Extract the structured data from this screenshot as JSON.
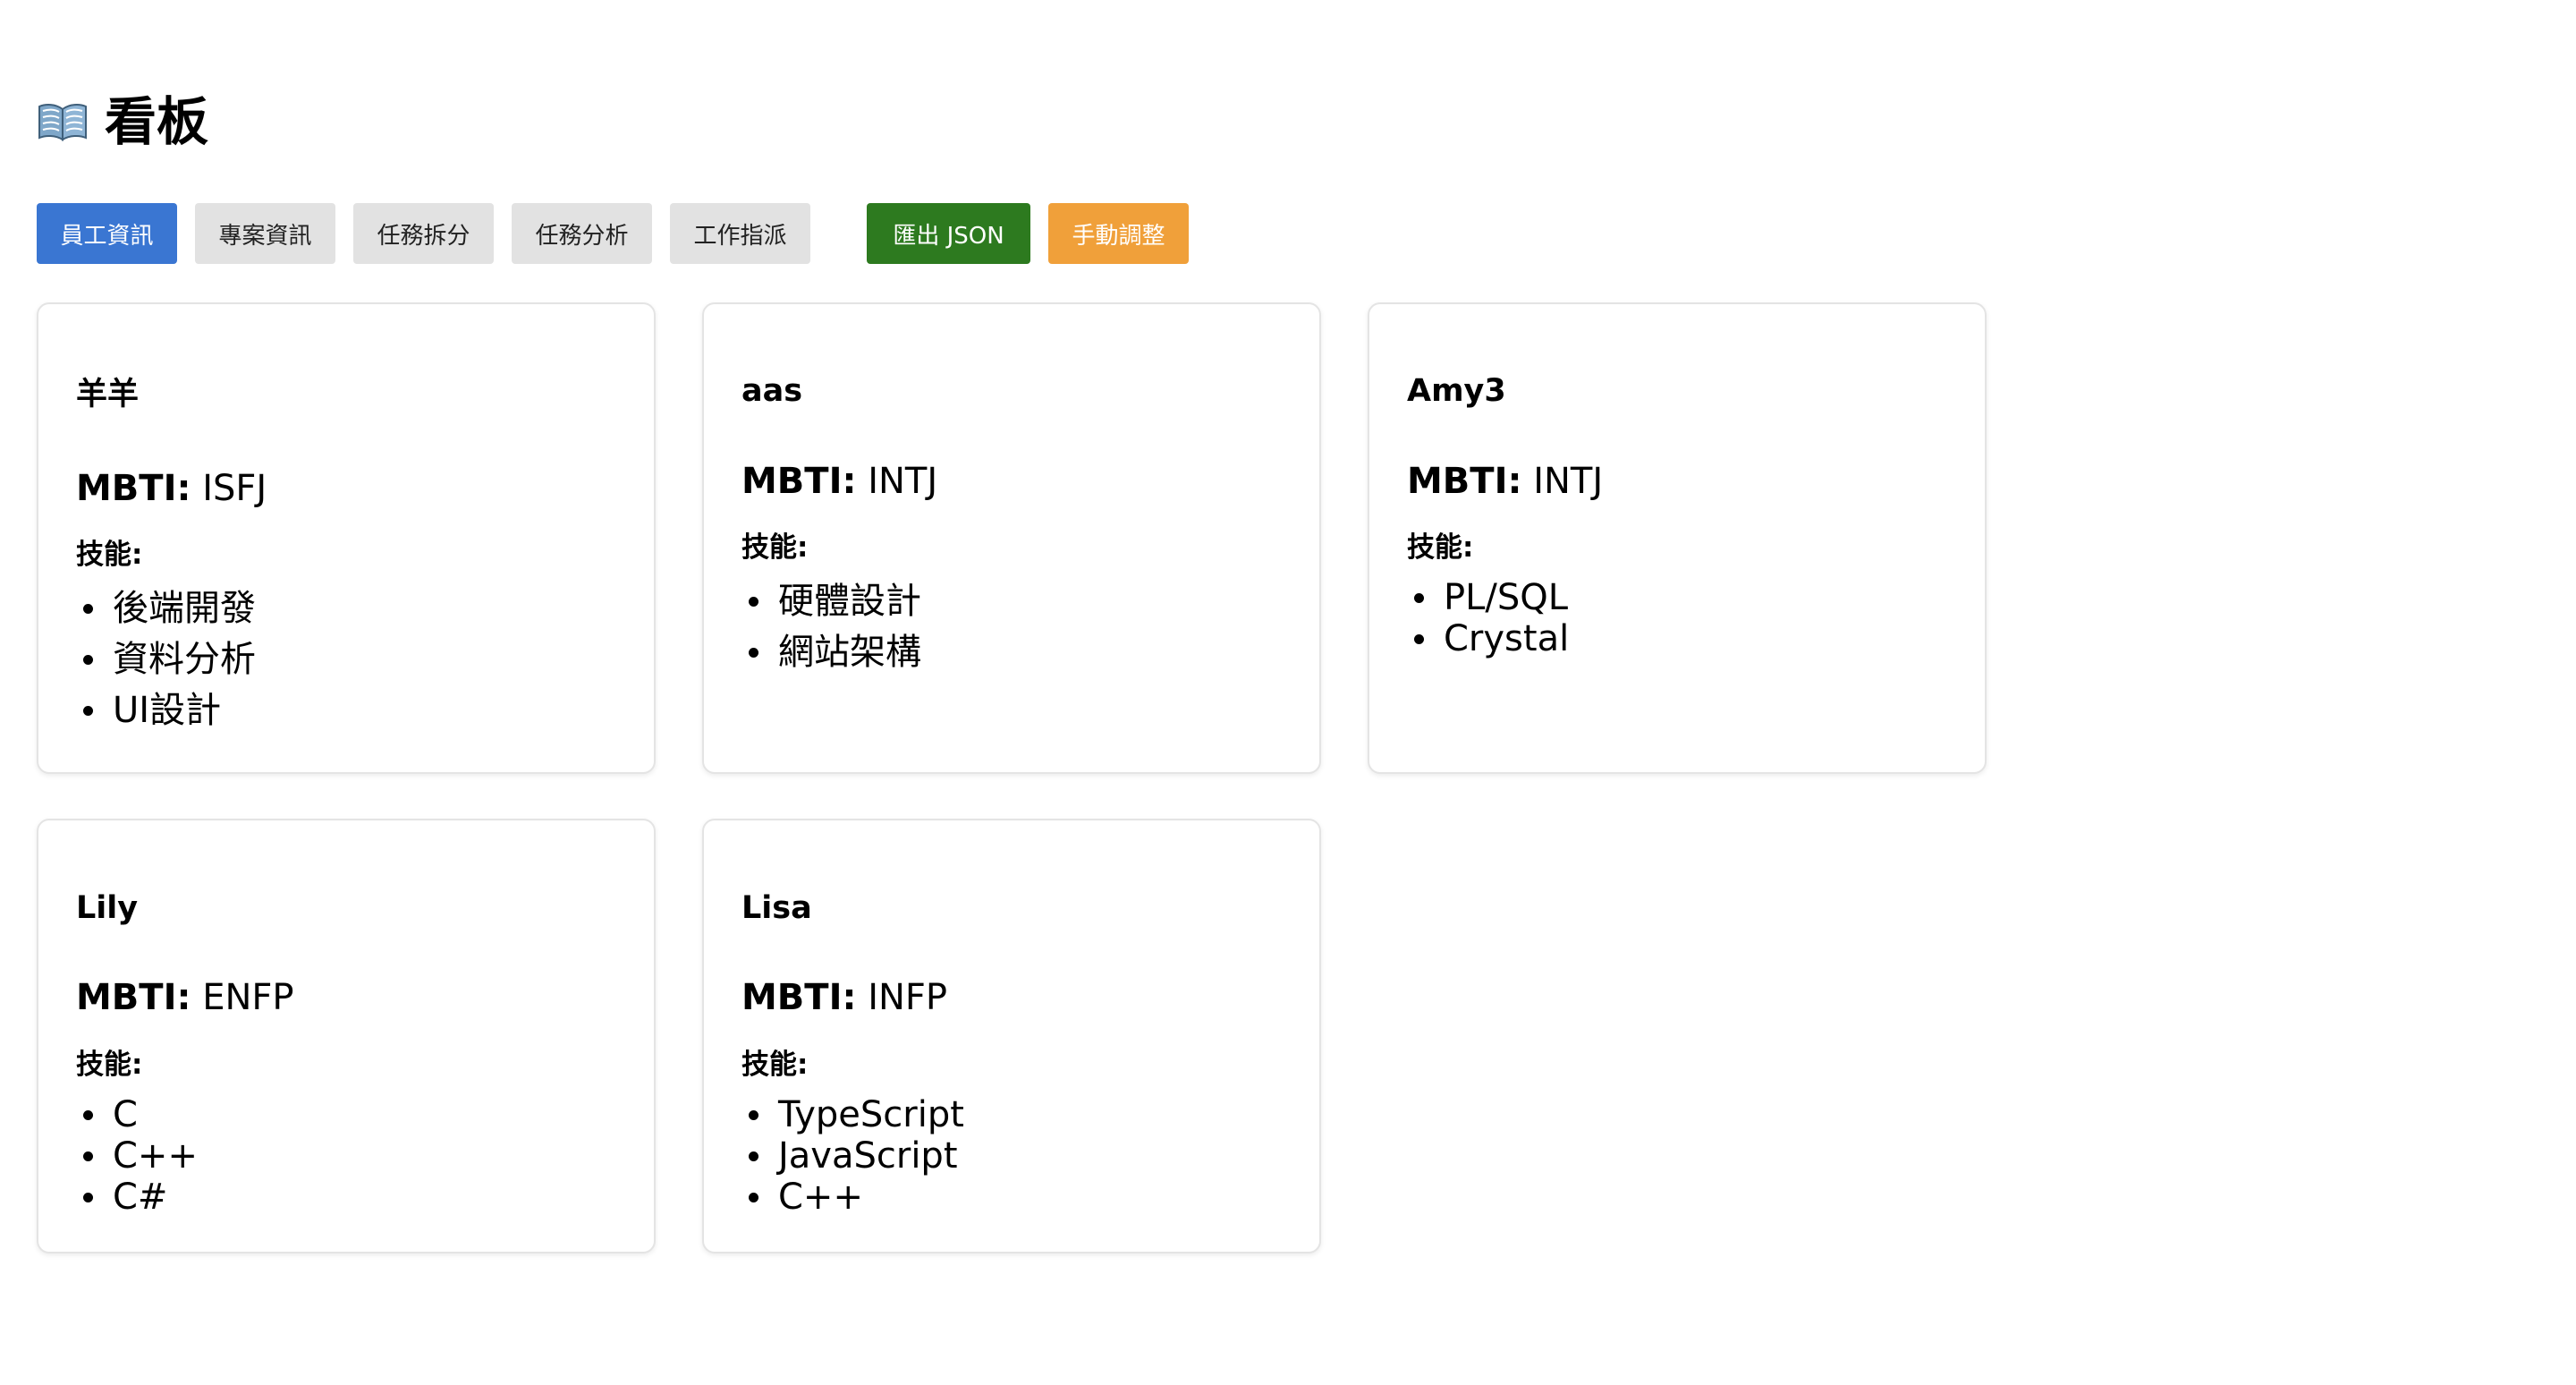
{
  "header": {
    "icon": "open-book-icon",
    "title": "看板"
  },
  "toolbar": {
    "tabs": [
      {
        "label": "員工資訊",
        "active": true
      },
      {
        "label": "專案資訊",
        "active": false
      },
      {
        "label": "任務拆分",
        "active": false
      },
      {
        "label": "任務分析",
        "active": false
      },
      {
        "label": "工作指派",
        "active": false
      }
    ],
    "export_label": "匯出 JSON",
    "manual_label": "手動調整"
  },
  "colors": {
    "active_tab": "#3a76d2",
    "inactive_tab": "#e2e2e2",
    "export_button": "#2d7a1f",
    "manual_button": "#f0a03a"
  },
  "mbti_label": "MBTI:",
  "skills_label": "技能:",
  "employees": [
    {
      "name": "羊羊",
      "mbti": "ISFJ",
      "skills": [
        "後端開發",
        "資料分析",
        "UI設計"
      ]
    },
    {
      "name": "aas",
      "mbti": "INTJ",
      "skills": [
        "硬體設計",
        "網站架構"
      ]
    },
    {
      "name": "Amy3",
      "mbti": "INTJ",
      "skills": [
        "PL/SQL",
        "Crystal"
      ]
    },
    {
      "name": "Lily",
      "mbti": "ENFP",
      "skills": [
        "C",
        "C++",
        "C#"
      ]
    },
    {
      "name": "Lisa",
      "mbti": "INFP",
      "skills": [
        "TypeScript",
        "JavaScript",
        "C++"
      ]
    }
  ]
}
